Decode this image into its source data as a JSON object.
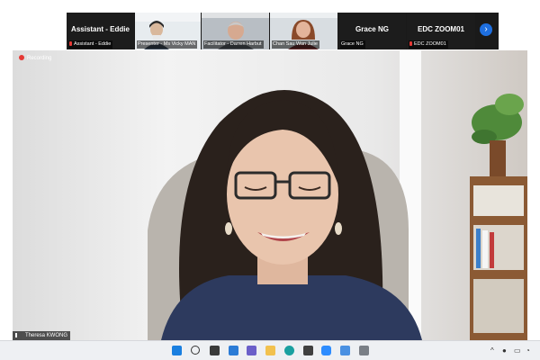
{
  "meeting": {
    "recording_label": "Recording",
    "active_speaker": "Theresa KWONG"
  },
  "thumbnails": [
    {
      "big_name": "Assistant - Eddie",
      "caption": "Assistant - Eddie",
      "muted": true
    },
    {
      "big_name": "",
      "caption": "Presenter - Ms Vicky MAN",
      "muted": false
    },
    {
      "big_name": "",
      "caption": "Facilitator - Darren Harbut",
      "muted": false
    },
    {
      "big_name": "",
      "caption": "Chan Sau Wan Julie",
      "muted": false
    },
    {
      "big_name": "Grace NG",
      "caption": "Grace NG",
      "muted": false
    },
    {
      "big_name": "EDC ZOOM01",
      "caption": "EDC ZOOM01",
      "muted": true
    }
  ],
  "taskbar": {
    "apps": [
      "windows-start",
      "search",
      "task-view",
      "widgets",
      "teams-chat",
      "file-explorer",
      "edge",
      "store",
      "zoom",
      "photos",
      "calculator"
    ],
    "tray": [
      "chevron-up",
      "microphone",
      "battery",
      "wifi",
      "volume"
    ]
  },
  "colors": {
    "accent": "#1e6fe0",
    "recording": "#e53935"
  }
}
